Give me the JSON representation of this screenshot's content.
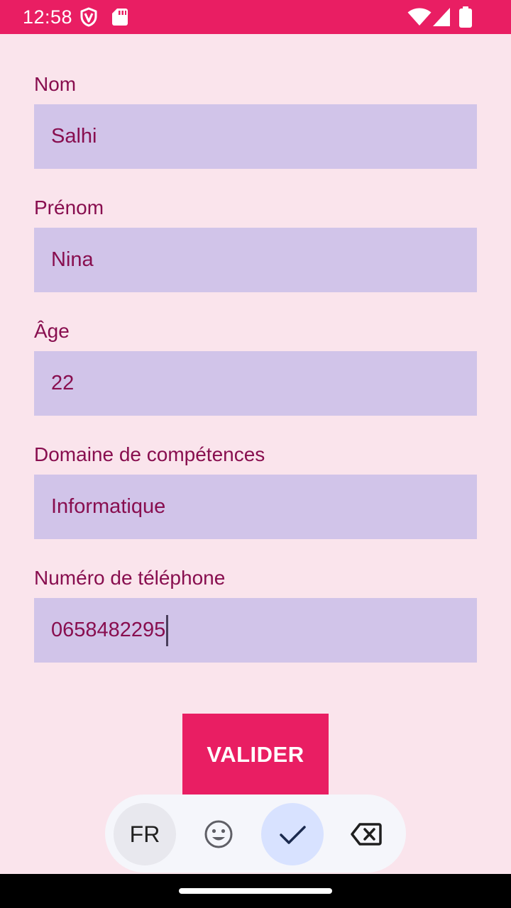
{
  "status_bar": {
    "time": "12:58",
    "icons": [
      "shield-icon",
      "sd-card-icon",
      "wifi-icon",
      "signal-icon",
      "battery-icon"
    ],
    "background": "#E91E63"
  },
  "form": {
    "fields": [
      {
        "label": "Nom",
        "value": "Salhi"
      },
      {
        "label": "Prénom",
        "value": "Nina"
      },
      {
        "label": "Âge",
        "value": "22"
      },
      {
        "label": "Domaine de compétences",
        "value": "Informatique"
      },
      {
        "label": "Numéro de téléphone",
        "value": "0658482295"
      }
    ],
    "submit_label": "VALIDER"
  },
  "keyboard_toolbar": {
    "language_label": "FR",
    "keys": [
      "language-key",
      "emoji-icon",
      "check-icon",
      "backspace-icon"
    ]
  },
  "colors": {
    "background": "#FAE4EC",
    "accent": "#E91E63",
    "label_text": "#880E4F",
    "field_background": "#D1C4E9"
  }
}
